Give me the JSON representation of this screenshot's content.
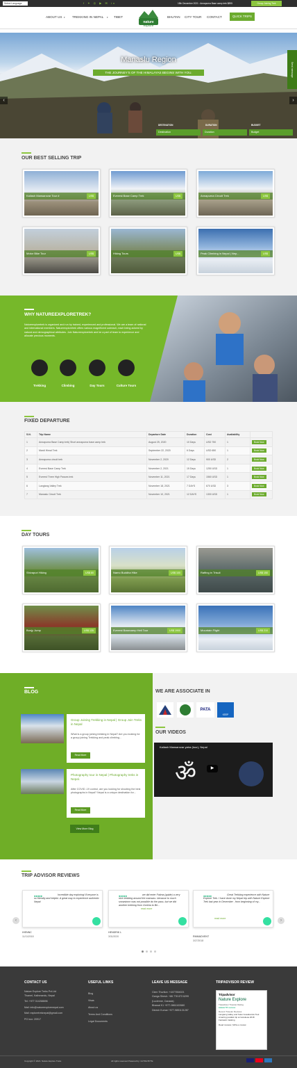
{
  "topbar": {
    "language": "Select Language",
    "note": "15th December 2021 : Annapurna Base camp trek $895",
    "button": "Group Joining Trek"
  },
  "nav": {
    "items": [
      "ABOUT US",
      "TREKKING IN NEPAL",
      "TIBET",
      "BHUTAN",
      "CITY TOUR",
      "CONTACT"
    ],
    "quick": "QUICK TRIPS",
    "logo": "nature explore"
  },
  "hero": {
    "title": "Manaslu Region",
    "subtitle": "THE JOURNEY'S OF THE HIMALAYAS BEGINS WITH YOU.",
    "side": "Send message",
    "search": {
      "labels": [
        "DESTINATION",
        "DURATION",
        "BUDGET"
      ],
      "fields": [
        "Destination",
        "Duration",
        "Budget"
      ]
    }
  },
  "best": {
    "title": "OUR BEST SELLING TRIP",
    "cards": [
      {
        "name": "Kailash Mansarovar Tour #",
        "price": "US$"
      },
      {
        "name": "Everest Base Camp Trek",
        "price": "US$"
      },
      {
        "name": "Annapurna Circuit Trek",
        "price": "US$"
      },
      {
        "name": "Motor Bike Tour",
        "price": "US$"
      },
      {
        "name": "Hiking Tours",
        "price": "US$"
      },
      {
        "name": "Peak Climbing in Nepal | Nep...",
        "price": "US$"
      }
    ]
  },
  "why": {
    "title": "WHY NATUREEXPLORETREK?",
    "text": "Natureexploretrek is organized and run by trained, experienced and professional. We are a team of national and international members. Natureexploretrek offers various magnificent outreach, each being adored by natural and demographical attributes. Join Natureexploretrek and be a part of team to experience and allocate precious moments.",
    "items": [
      "Trekking",
      "Climbing",
      "Day Tours",
      "Culture Tours"
    ]
  },
  "departure": {
    "title": "FIXED DEPARTURE",
    "headers": [
      "S.N.",
      "Trip Name",
      "Departure Date",
      "Duration",
      "Cost",
      "Availability",
      ""
    ],
    "book": "Book Now",
    "rows": [
      [
        "1",
        "Annapurna Base Camp trek| Short annapurna base camp trek",
        "August 25, 2020",
        "10 Days",
        "USD 750",
        "1"
      ],
      [
        "2",
        "Mardi Himal Trek",
        "September 22, 2020",
        "6 Days",
        "USD 650",
        "1"
      ],
      [
        "3",
        "Annapurna circuit trek",
        "November 2, 2020",
        "12 Days",
        "900 USD",
        "2"
      ],
      [
        "4",
        "Everest Base Camp Trek",
        "November 2, 2021",
        "15 Days",
        "1250 USD",
        "1"
      ],
      [
        "5",
        "Everest Three High Passes trek",
        "November 11, 2021",
        "17 Days",
        "1560 USD",
        "1"
      ],
      [
        "6",
        "Langtang Valley Trek",
        "November 18, 2021",
        "7 DAYS",
        "670 USD",
        "3"
      ],
      [
        "7",
        "Manaslu Circuit Trek",
        "November 10, 2021",
        "12 DAYS",
        "1300 USD",
        "1"
      ]
    ]
  },
  "daytours": {
    "title": "DAY TOURS",
    "cards": [
      {
        "name": "Shivapuri Hiking",
        "price": "US$ 80"
      },
      {
        "name": "Namo Buddha Hike",
        "price": "US$ 100"
      },
      {
        "name": "Rafting in Trisuli",
        "price": "US$ 150"
      },
      {
        "name": "Bunjy Jump",
        "price": "US$ 135"
      },
      {
        "name": "Everest Basecamp Heli Tour",
        "price": "US$ 1900"
      },
      {
        "name": "Mountain Flight",
        "price": "US$ 210"
      }
    ]
  },
  "blog": {
    "title": "BLOG",
    "posts": [
      {
        "title": "Group Joining Trekking in Nepal | Group Join Treks in Nepal",
        "text": "What is a group joining trekking in Nepal? Are you looking for a group joining Trekking and peak climbing...",
        "more": "Read More"
      },
      {
        "title": "Photography tour in Nepal | Photography treks in Nepal.",
        "text": "After COVID -19 control, are you looking for shooting the best photographs in Nepal? Nepal is a unique destination for...",
        "more": "Read More"
      }
    ],
    "viewall": "View More Blog"
  },
  "associate": {
    "title": "WE ARE ASSOCIATE IN",
    "logos": [
      "PATA",
      "KEEP"
    ]
  },
  "videos": {
    "title": "OUR VIDEOS",
    "caption": "Kailash Mansarovar yatra (tour), Nepal"
  },
  "reviews": {
    "title": "TRIP ADVISOR REVIEWS",
    "items": [
      {
        "text": "Incredible day exploring! Everyone is so friendly and helpful. A great way to experience authentic Nepal",
        "name": "IHENNC",
        "date": "11/11/2018"
      },
      {
        "text": "we did enter Fatima (guide) a very nice trekking around the mansaru. because to much snowstorm was not possible do the pass. but we did another trekking from Gorkha to Be...",
        "more": "read more",
        "name": "HENDRIK L",
        "date": "3/31/2020"
      },
      {
        "text": "Great Trekking experience with Nature Explore Trek. I have done my Nepal trip with Nature Explore Trek last year in December , from beginning of my...",
        "more": "read more",
        "name": "RMMADVENT",
        "date": "3/27/2018"
      }
    ]
  },
  "footer": {
    "contact": {
      "title": "CONTACT US",
      "lines": [
        "Nature Explore Treks Pvt.Ltd",
        "Thamel, Kathmandu, Nepal",
        "Tel: +977 014268696",
        "Mail: info@natureexplorenepal.com",
        "Mail: exploretreknepal@gmail.com",
        "PO box: 20917"
      ]
    },
    "links": {
      "title": "USEFUL LINKS",
      "items": [
        "Blog",
        "Visas",
        "About us",
        "Terms And Conditions",
        "Legal Documents"
      ]
    },
    "message": {
      "title": "LEAVE US MESSAGE",
      "lines": [
        "Clem Thurlton: +4477654021",
        "Ganga Shesh: +86 778 873 6299",
        "(Lucienne, Canada)",
        "Bhawal K1 +977-9861102680",
        "Dinesh Kumar +977-9851131287"
      ]
    },
    "tripadvisor": {
      "title": "TRIPADVISOR REVIEW",
      "brand": "Tripadvisor",
      "name": "Nature Explore",
      "sub": "Tripadvisor Traveler Rating",
      "reviews": "55 reviews",
      "recent": "Recent Traveler Reviews",
      "r1": "Langtang Valley and Suku Gosaikunda Trek",
      "r2": "Amazing parallel trip at Gokulesa 2018",
      "r3": "Fantastic trekking",
      "links": "Read reviews | Write a review"
    },
    "copyright": "Copyright © 2021. Nature Explore Treks",
    "credits": "All rights reserved Powered by: ULTRA BYTE"
  }
}
